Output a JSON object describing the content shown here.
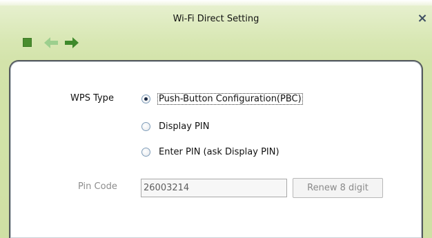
{
  "window": {
    "title": "Wi-Fi Direct Setting",
    "close_icon": "×"
  },
  "toolbar": {
    "icons": [
      "stop-icon",
      "back-arrow-icon",
      "forward-arrow-icon"
    ]
  },
  "colors": {
    "frame_green": "#d3e3aa",
    "icon_green": "#4a8d2f",
    "back_arrow_disabled": "#9ccf8e",
    "panel_border": "#555a5e"
  },
  "form": {
    "wps_type_label": "WPS Type",
    "options": [
      {
        "label": "Push-Button Configuration(PBC)",
        "checked": true
      },
      {
        "label": "Display PIN",
        "checked": false
      },
      {
        "label": "Enter PIN (ask Display PIN)",
        "checked": false
      }
    ],
    "pin_code_label": "Pin Code",
    "pin_code_value": "26003214",
    "renew_button_label": "Renew 8 digit"
  }
}
